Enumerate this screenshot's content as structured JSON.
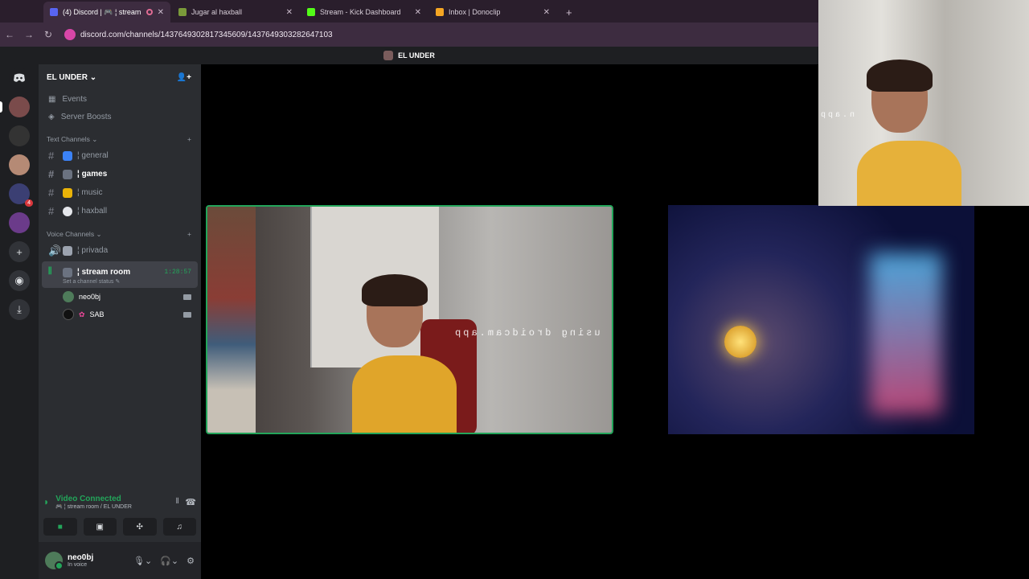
{
  "browser": {
    "tabs": [
      {
        "title": "(4) Discord | 🎮 ¦ stream",
        "active": true,
        "favicon_color": "#5865f2"
      },
      {
        "title": "Jugar al haxball",
        "active": false,
        "favicon_color": "#7a9a3a"
      },
      {
        "title": "Stream - Kick Dashboard",
        "active": false,
        "favicon_color": "#53fc18"
      },
      {
        "title": "Inbox | Donoclip",
        "active": false,
        "favicon_color": "#f5a623"
      }
    ],
    "url": "discord.com/channels/1437649302817345609/1437649303282647103"
  },
  "app_title": "EL UNDER",
  "server": {
    "name": "EL UNDER",
    "events_label": "Events",
    "boosts_label": "Server Boosts"
  },
  "rail": {
    "dm_badge": "4"
  },
  "text_channels": {
    "category": "Text Channels",
    "items": [
      {
        "label": "¦ general",
        "emoji_color": "#3b82f6",
        "bright": false
      },
      {
        "label": "¦ games",
        "emoji_color": "#6b7280",
        "bright": true
      },
      {
        "label": "¦ music",
        "emoji_color": "#eab308",
        "bright": false
      },
      {
        "label": "¦ haxball",
        "emoji_color": "#e5e7eb",
        "bright": false
      }
    ]
  },
  "voice_channels": {
    "category": "Voice Channels",
    "privada": "¦ privada",
    "active": {
      "label": "¦ stream room",
      "timer": "1:28:57",
      "status": "Set a channel status"
    },
    "users": [
      {
        "name": "neo0bj",
        "avatar_color": "#4e7b5a"
      },
      {
        "name": "SAB",
        "avatar_color": "#111111"
      }
    ]
  },
  "voice_panel": {
    "status": "Video Connected",
    "location": "🎮 ¦ stream room / EL UNDER"
  },
  "user": {
    "name": "neo0bj",
    "status": "In voice"
  },
  "watermark": "using droidcam.app",
  "overlay_watermark": "n.app"
}
